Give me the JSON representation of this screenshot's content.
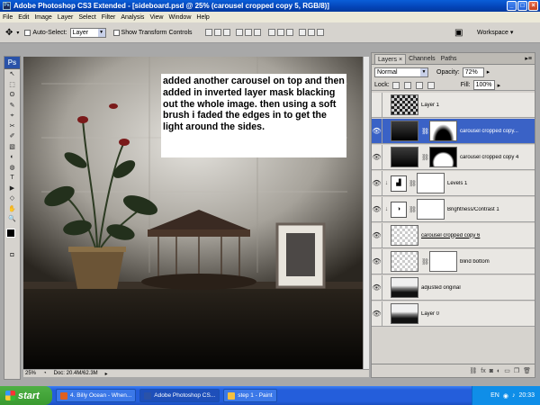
{
  "window": {
    "title": "Adobe Photoshop CS3 Extended - [sideboard.psd @ 25% (carousel cropped copy 5, RGB/8)]",
    "app_icon_label": "Ps"
  },
  "menu": [
    "File",
    "Edit",
    "Image",
    "Layer",
    "Select",
    "Filter",
    "Analysis",
    "View",
    "Window",
    "Help"
  ],
  "options": {
    "auto_select_label": "Auto-Select:",
    "auto_select_value": "Layer",
    "show_transform_label": "Show Transform Controls",
    "workspace_label": "Workspace"
  },
  "toolbox": {
    "logo": "Ps",
    "tools": [
      "↖",
      "⬚",
      "ʘ",
      "✎",
      "⌖",
      "✂",
      "✐",
      "▧",
      "◐",
      "◍",
      "T",
      "▶",
      "◇",
      "✋",
      "🔍"
    ]
  },
  "canvas": {
    "annotation": "added another carousel on top and then added in inverted layer mask blacking out the whole image. then using a soft brush i faded the edges in to get the light around the sides."
  },
  "statusbar": {
    "zoom": "25%",
    "doc": "Doc: 20.4M/62.3M"
  },
  "layers_panel": {
    "tabs": [
      "Layers",
      "Channels",
      "Paths"
    ],
    "tab_close": "×",
    "blend_mode": "Normal",
    "opacity_label": "Opacity:",
    "opacity_value": "72%",
    "lock_label": "Lock:",
    "fill_label": "Fill:",
    "fill_value": "100%",
    "layers": [
      {
        "name": "Layer 1",
        "visible": false,
        "thumb": "checker-dark",
        "mask": false
      },
      {
        "name": "carousel cropped copy...",
        "visible": true,
        "thumb": "checker-dark",
        "mask": "white",
        "active": true
      },
      {
        "name": "carousel cropped copy 4",
        "visible": true,
        "thumb": "checker-dark",
        "mask": "radial"
      },
      {
        "name": "Levels 1",
        "visible": true,
        "thumb": "adjust-levels",
        "mask": "white",
        "clipped": true
      },
      {
        "name": "Brightness/Contrast 1",
        "visible": true,
        "thumb": "adjust-brightness",
        "mask": "white",
        "clipped": true
      },
      {
        "name": "carousel cropped copy 6",
        "visible": true,
        "thumb": "checker-dark",
        "mask": false
      },
      {
        "name": "blind bottom",
        "visible": true,
        "thumb": "checker",
        "mask": "white"
      },
      {
        "name": "adjusted original",
        "visible": true,
        "thumb": "photo",
        "mask": false
      },
      {
        "name": "Layer 0",
        "visible": true,
        "thumb": "photo",
        "mask": false
      }
    ]
  },
  "taskbar": {
    "start_label": "start",
    "tasks": [
      "4. Billy Ocean - When...",
      "Adobe Photoshop CS...",
      "step 1 - Paint"
    ],
    "language": "EN",
    "clock": "20:33"
  },
  "colors": {
    "title_blue": "#0444b8",
    "selection_blue": "#3a62c6",
    "taskbar_blue": "#245edb",
    "start_green": "#3a9a30"
  }
}
